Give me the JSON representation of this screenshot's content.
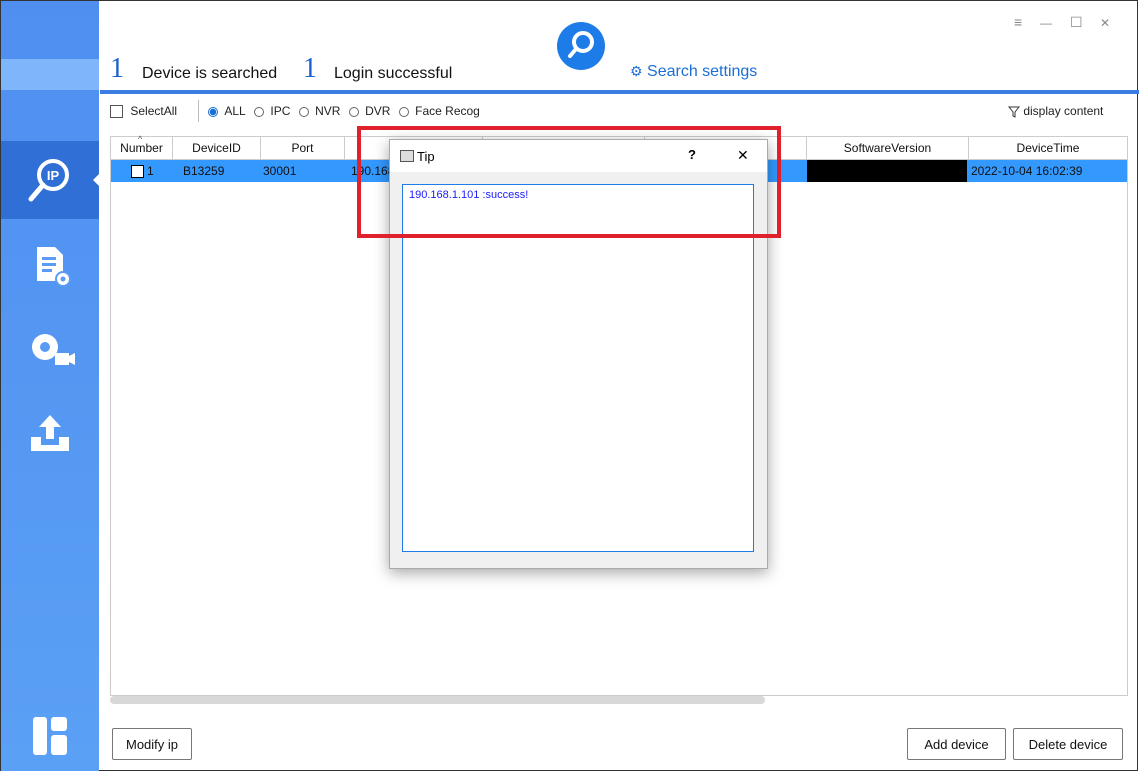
{
  "header": {
    "searched_count": "1",
    "searched_label": "Device is searched",
    "login_count": "1",
    "login_label": "Login successful",
    "search_settings": "Search settings"
  },
  "filter": {
    "select_all": "SelectAll",
    "options": [
      "ALL",
      "IPC",
      "NVR",
      "DVR",
      "Face Recog"
    ],
    "selected": "ALL",
    "display_content": "display content"
  },
  "table": {
    "columns": [
      "Number",
      "DeviceID",
      "Port",
      "",
      "",
      "",
      "SoftwareVersion",
      "DeviceTime"
    ],
    "rows": [
      {
        "number": "1",
        "device_id": "B13259",
        "port": "30001",
        "ip": "190.168",
        "software_version": "",
        "device_time": "2022-10-04 16:02:39"
      }
    ]
  },
  "dialog": {
    "title": "Tip",
    "help": "?",
    "close": "✕",
    "message": "190.168.1.101 :success!"
  },
  "buttons": {
    "modify_ip": "Modify ip",
    "add_device": "Add device",
    "delete_device": "Delete device"
  },
  "window_controls": {
    "menu": "≡",
    "minimize": "—",
    "maximize": "☐",
    "close": "✕"
  },
  "colors": {
    "accent": "#1e7ce8",
    "sidebar": "#5a9bf3",
    "highlight": "#e0202c",
    "row_selected": "#3399ff"
  }
}
